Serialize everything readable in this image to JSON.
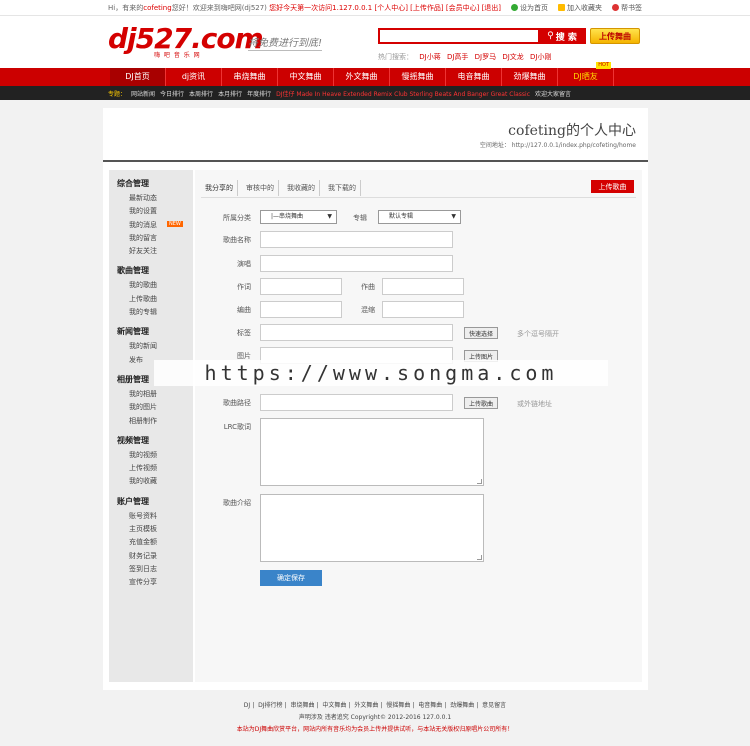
{
  "topbar": {
    "greeting": "Hi，有来的",
    "user": "cofeting",
    "welcome": "您好！欢迎来到嗨吧网(dj527)",
    "notice": "您好今天第一次访问1.127.0.0.1",
    "links": [
      "[个人中心]",
      "[上传作品]",
      "[会员中心]",
      "[退出]"
    ],
    "right": [
      "设为首页",
      "加入收藏夹",
      "帮书签"
    ]
  },
  "header": {
    "logo_text": "dj527.com",
    "logo_sub": "嗨 吧 音 乐 网",
    "slogan": "将免费进行到底!",
    "search_button": "搜 索",
    "upload_button": "上传舞曲",
    "hot_label": "热门搜索：",
    "hot_keywords": [
      "DJ小蒋",
      "DJ高手",
      "DJ罗马",
      "DJ文龙",
      "DJ小刚"
    ]
  },
  "nav": {
    "items": [
      "DJ首页",
      "dj资讯",
      "串烧舞曲",
      "中文舞曲",
      "外文舞曲",
      "慢摇舞曲",
      "电音舞曲",
      "劲爆舞曲",
      "DJ晒友"
    ],
    "hot_badge": "HOT"
  },
  "subnav": {
    "label": "专题：",
    "items": [
      "网站新闻",
      "今日排行",
      "本周排行",
      "本月排行",
      "年度排行"
    ],
    "scroll_text": "DJ佳仔 Made In Heave Extended Remix Club Sterling Beats And Banger Great Classic",
    "tail": "欢迎大家留言"
  },
  "profile": {
    "title": "cofeting的个人中心",
    "space_label": "空间地址：",
    "space_url": "http://127.0.0.1/index.php/cofeting/home"
  },
  "sidebar": [
    {
      "title": "综合管理",
      "items": [
        "最新动态",
        "我的设置",
        "我的消息",
        "我的留言",
        "好友关注"
      ],
      "new_index": 2,
      "new_label": "NEW"
    },
    {
      "title": "歌曲管理",
      "items": [
        "我的歌曲",
        "上传歌曲",
        "我的专辑"
      ]
    },
    {
      "title": "新闻管理",
      "items": [
        "我的新闻",
        "发布"
      ]
    },
    {
      "title": "相册管理",
      "items": [
        "我的相册",
        "我的图片",
        "相册制作"
      ]
    },
    {
      "title": "视频管理",
      "items": [
        "我的视频",
        "上传视频",
        "我的收藏"
      ]
    },
    {
      "title": "账户管理",
      "items": [
        "账号资料",
        "主页模板",
        "充值金额",
        "财务记录",
        "签到日志",
        "宣传分享"
      ]
    }
  ],
  "tabs": [
    "我分享的",
    "审核中的",
    "我收藏的",
    "我下载的"
  ],
  "upload_song": "上传歌曲",
  "form": {
    "category_label": "所属分类",
    "category_value": "|—串烧舞曲",
    "album_label": "专辑",
    "album_value": "默认专辑",
    "song_name_label": "歌曲名称",
    "singer_label": "演唱",
    "lyricist_label": "作词",
    "composer_label": "作曲",
    "arranger_label": "编曲",
    "mix_label": "混缩",
    "tags_label": "标签",
    "tags_button": "快速选择",
    "tags_hint": "多个逗号隔开",
    "image_label": "图片",
    "image_button": "上传图片",
    "path_label": "歌曲路径",
    "path_button": "上传歌曲",
    "path_hint": "或外链地址",
    "lrc_label": "LRC歌词",
    "intro_label": "歌曲介绍",
    "submit": "确定保存"
  },
  "watermark": "https://www.songma.com",
  "footer": {
    "links": [
      "DJ",
      "DJ排行榜",
      "串烧舞曲",
      "中文舞曲",
      "外文舞曲",
      "慢摇舞曲",
      "电音舞曲",
      "劲爆舞曲",
      "意见留言"
    ],
    "line2": "声明涉及 违者追究 Copyright© 2012-2016 127.0.0.1",
    "line3": "本站为DJ舞曲欣赏平台，网站内所有音乐均为会员上传并提供试听，与本站无关版权归原唱片公司所有！"
  },
  "colors": {
    "brand_red": "#cc0000",
    "submit_blue": "#3a84c9",
    "hot_yellow": "#ffd800"
  }
}
